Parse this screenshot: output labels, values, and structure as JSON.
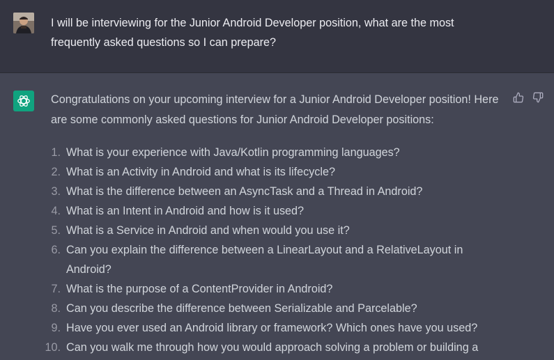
{
  "user_message": {
    "avatar": "user-avatar-photo",
    "text": "I will be interviewing for the Junior Android Developer position, what are the most frequently asked questions so I can prepare?"
  },
  "assistant_message": {
    "avatar": "openai-logo-icon",
    "intro": "Congratulations on your upcoming interview for a Junior Android Developer position! Here are some commonly asked questions for Junior Android Developer positions:",
    "feedback": {
      "thumbs_up": "thumbs-up-icon",
      "thumbs_down": "thumbs-down-icon"
    },
    "questions": [
      {
        "num": "1.",
        "text": "What is your experience with Java/Kotlin programming languages?"
      },
      {
        "num": "2.",
        "text": "What is an Activity in Android and what is its lifecycle?"
      },
      {
        "num": "3.",
        "text": "What is the difference between an AsyncTask and a Thread in Android?"
      },
      {
        "num": "4.",
        "text": "What is an Intent in Android and how is it used?"
      },
      {
        "num": "5.",
        "text": "What is a Service in Android and when would you use it?"
      },
      {
        "num": "6.",
        "text": "Can you explain the difference between a LinearLayout and a RelativeLayout in Android?"
      },
      {
        "num": "7.",
        "text": "What is the purpose of a ContentProvider in Android?"
      },
      {
        "num": "8.",
        "text": "Can you describe the difference between Serializable and Parcelable?"
      },
      {
        "num": "9.",
        "text": "Have you ever used an Android library or framework? Which ones have you used?"
      },
      {
        "num": "10.",
        "text": "Can you walk me through how you would approach solving a problem or building a"
      }
    ]
  },
  "colors": {
    "user_bg": "#343541",
    "assistant_bg": "#444654",
    "accent": "#10a37f",
    "text": "#d1d5db"
  }
}
